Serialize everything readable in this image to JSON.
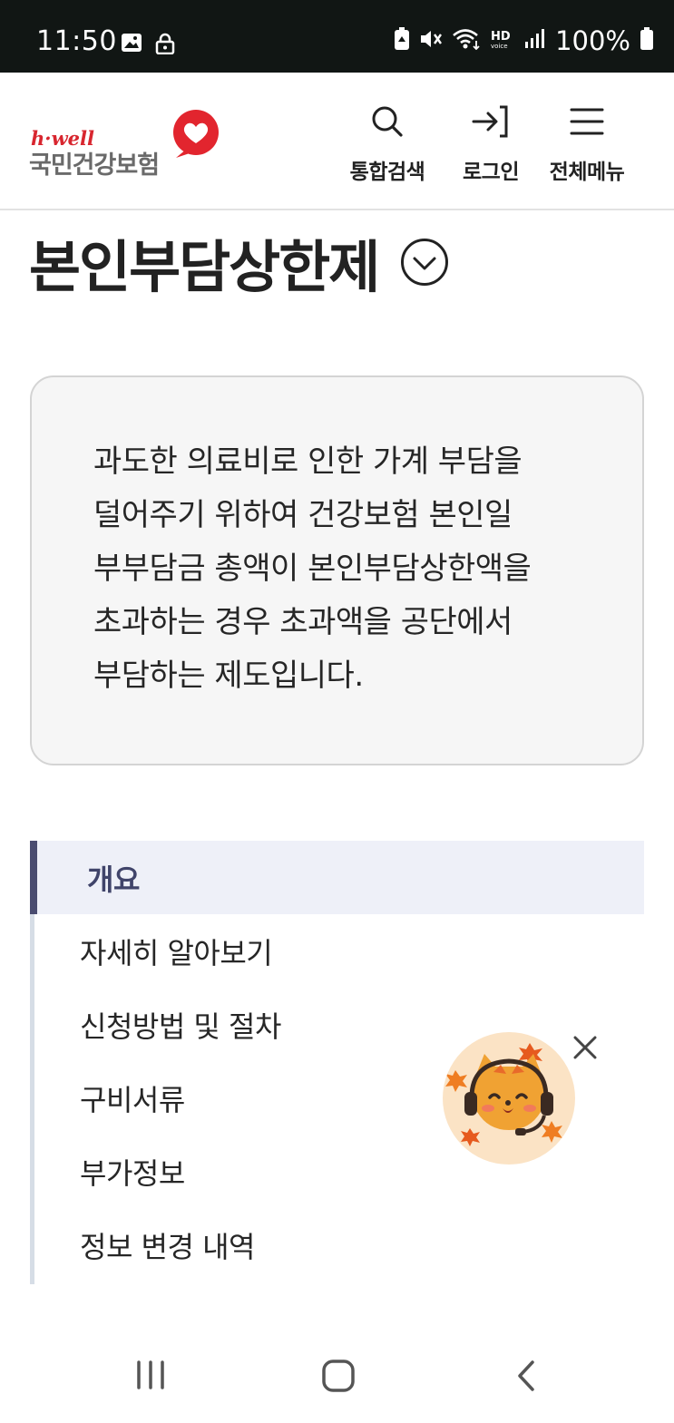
{
  "status_bar": {
    "time": "11:50",
    "battery": "100%",
    "icons": [
      "image-icon",
      "lock-icon",
      "battery-saver-icon",
      "mute-icon",
      "wifi-icon",
      "hd-voice-icon",
      "signal-icon",
      "battery-icon"
    ]
  },
  "header": {
    "logo_tagline": "h·well",
    "logo_name": "국민건강보험",
    "nav": [
      {
        "label": "통합검색",
        "icon": "search-icon"
      },
      {
        "label": "로그인",
        "icon": "login-icon"
      },
      {
        "label": "전체메뉴",
        "icon": "menu-icon"
      }
    ]
  },
  "page": {
    "title": "본인부담상한제",
    "intro_lines": [
      "과도한 의료비로 인한 가계 부담을",
      "덜어주기 위하여 건강보험 본인일",
      "부부담금 총액이 본인부담상한액을",
      "초과하는 경우 초과액을 공단에서",
      "부담하는 제도입니다."
    ]
  },
  "toc": {
    "items": [
      {
        "label": "개요",
        "active": true
      },
      {
        "label": "자세히 알아보기",
        "active": false
      },
      {
        "label": "신청방법 및 절차",
        "active": false
      },
      {
        "label": "구비서류",
        "active": false
      },
      {
        "label": "부가정보",
        "active": false
      },
      {
        "label": "정보 변경 내역",
        "active": false
      }
    ]
  },
  "colors": {
    "brand_red": "#d8262f",
    "active_bg": "#eef0f8",
    "active_bar": "#4a4c70"
  }
}
